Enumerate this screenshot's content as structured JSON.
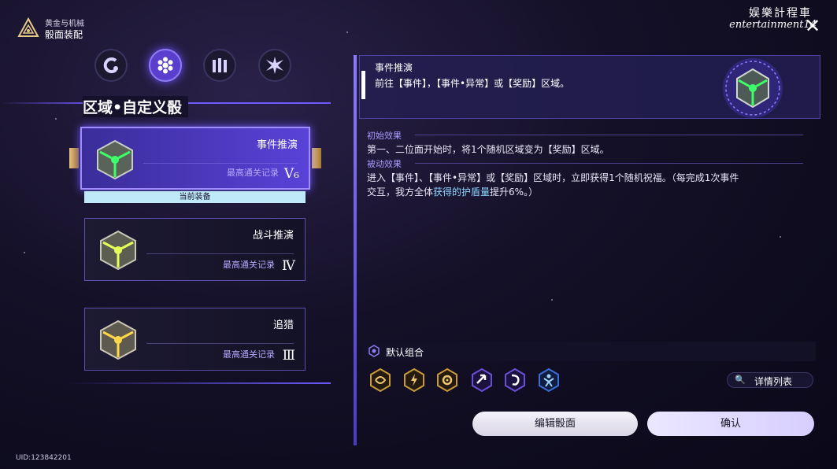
{
  "header": {
    "subtitle": "黄金与机械",
    "title": "骰面装配"
  },
  "watermark": {
    "cn": "娱樂計程車",
    "en": "entertainment14"
  },
  "tabs": [
    {
      "icon": "c-ring-icon"
    },
    {
      "icon": "hexagon-cluster-icon",
      "active": true
    },
    {
      "icon": "pillars-icon"
    },
    {
      "icon": "starburst-icon"
    }
  ],
  "section_title": "区域•自定义骰",
  "cards": [
    {
      "name": "事件推演",
      "record_label": "最高通关记录",
      "record_value": "V₆",
      "equipped": true,
      "glow": "#3cff6a"
    },
    {
      "name": "战斗推演",
      "record_label": "最高通关记录",
      "record_value": "Ⅳ",
      "equipped": false,
      "glow": "#e8ff5a"
    },
    {
      "name": "追猎",
      "record_label": "最高通关记录",
      "record_value": "Ⅲ",
      "equipped": false,
      "glow": "#ffd84a"
    }
  ],
  "equipped_label": "当前装备",
  "detail": {
    "title": "事件推演",
    "description": "前往【事件】，【事件•异常】或【奖励】区域。",
    "initial_label": "初始效果",
    "initial_text": "第一、二位面开始时，将1个随机区域变为【奖励】区域。",
    "passive_label": "被动效果",
    "passive_text_1": "进入【事件】、【事件•异常】或【奖励】区域时，立即获得1个随机祝福。（每完成1次事件",
    "passive_text_2a": "交互，我方全体",
    "passive_text_2b": "获得的护盾量",
    "passive_text_2c": "提升6%。）"
  },
  "combo": {
    "title": "默认组合",
    "blessings": [
      {
        "icon": "swirl-gold-icon",
        "color": "#c99a3a"
      },
      {
        "icon": "bolt-gold-icon",
        "color": "#c99a3a"
      },
      {
        "icon": "gear-gold-icon",
        "color": "#c99a3a"
      },
      {
        "icon": "arrow-purple-icon",
        "color": "#6b4fd6"
      },
      {
        "icon": "hook-purple-icon",
        "color": "#6b4fd6"
      },
      {
        "icon": "figure-blue-icon",
        "color": "#3a6fd6"
      }
    ],
    "detail_button": "详情列表"
  },
  "buttons": {
    "edit": "编辑骰面",
    "confirm": "确认"
  },
  "uid": "UID:123842201",
  "colors": {
    "accent": "#6e5aff",
    "equipped_bg": "#bfe9f9",
    "highlight": "#8ed7ff"
  }
}
